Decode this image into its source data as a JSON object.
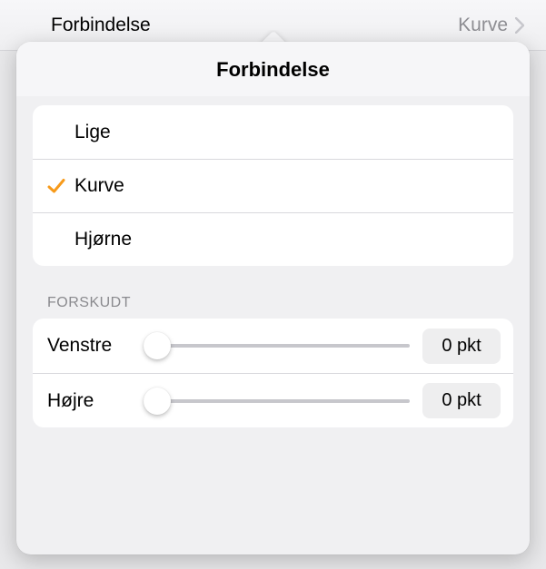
{
  "header": {
    "label": "Forbindelse",
    "value": "Kurve"
  },
  "popover": {
    "title": "Forbindelse",
    "options": [
      {
        "label": "Lige",
        "selected": false
      },
      {
        "label": "Kurve",
        "selected": true
      },
      {
        "label": "Hjørne",
        "selected": false
      }
    ],
    "offset": {
      "section_label": "FORSKUDT",
      "rows": [
        {
          "label": "Venstre",
          "value": "0 pkt"
        },
        {
          "label": "Højre",
          "value": "0 pkt"
        }
      ]
    }
  }
}
